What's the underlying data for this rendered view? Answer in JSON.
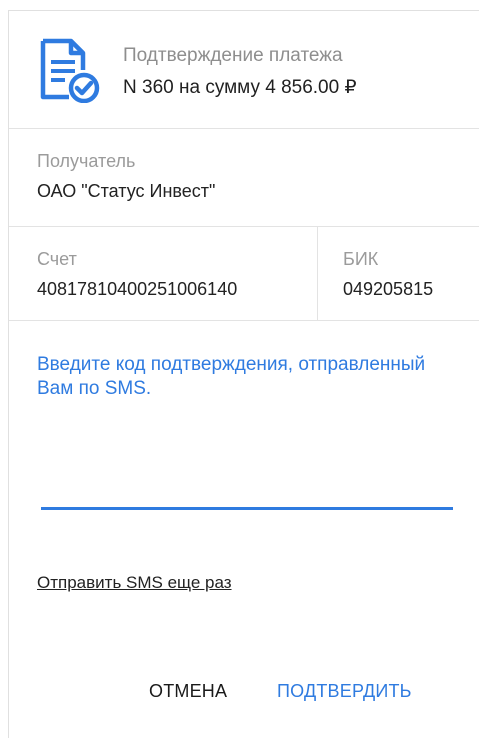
{
  "header": {
    "title": "Подтверждение платежа",
    "subtitle": "N 360 на сумму 4 856.00 ₽",
    "icon": "document-check-icon",
    "accent": "#2F7BE0"
  },
  "recipient": {
    "label": "Получатель",
    "value": "ОАО \"Статус Инвест\""
  },
  "account": {
    "label": "Счет",
    "value": "40817810400251006140"
  },
  "bik": {
    "label": "БИК",
    "value": "049205815"
  },
  "sms": {
    "prompt": "Введите код подтверждения, отправленный Вам по SMS.",
    "code_value": "",
    "resend_label": "Отправить SMS еще раз"
  },
  "actions": {
    "cancel_label": "ОТМЕНА",
    "confirm_label": "ПОДТВЕРДИТЬ"
  }
}
